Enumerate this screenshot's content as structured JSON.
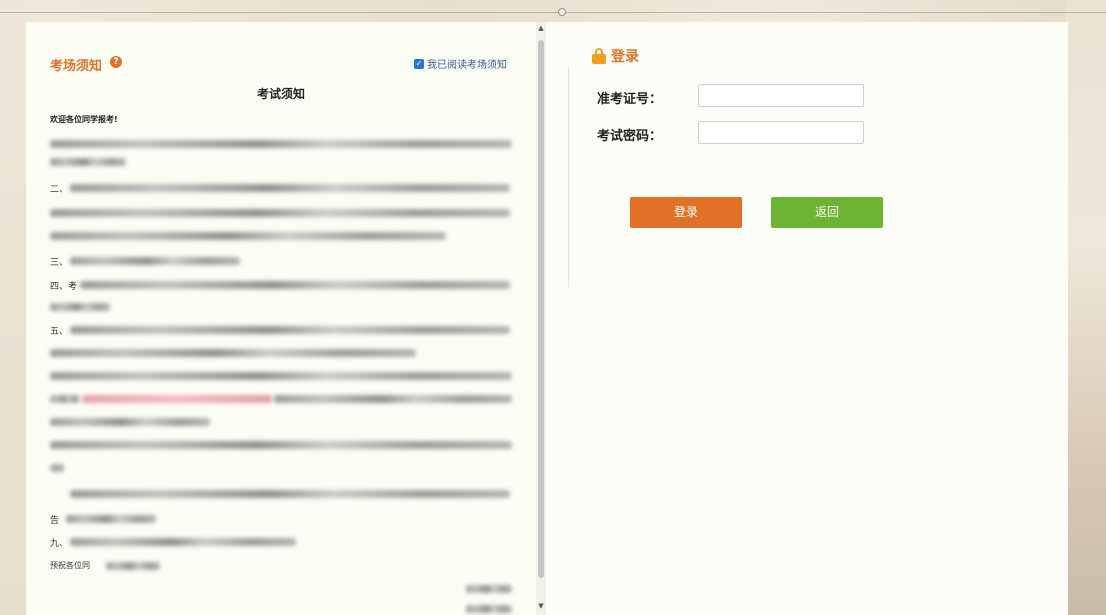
{
  "notice": {
    "title": "考场须知",
    "agree_label": "我已阅读考场须知",
    "agree_checked": true,
    "doc_title": "考试须知",
    "welcome": "欢迎各位同学报考!",
    "markers": [
      "二、",
      "三、",
      "四、考",
      "五、",
      "九、",
      "告",
      "预祝各位同"
    ]
  },
  "login": {
    "title": "登录",
    "ticket_label": "准考证号：",
    "ticket_value": "",
    "password_label": "考试密码：",
    "password_value": "",
    "login_button": "登录",
    "back_button": "返回"
  },
  "colors": {
    "accent": "#e0712a",
    "login_button": "#e07127",
    "back_button": "#6db432"
  }
}
